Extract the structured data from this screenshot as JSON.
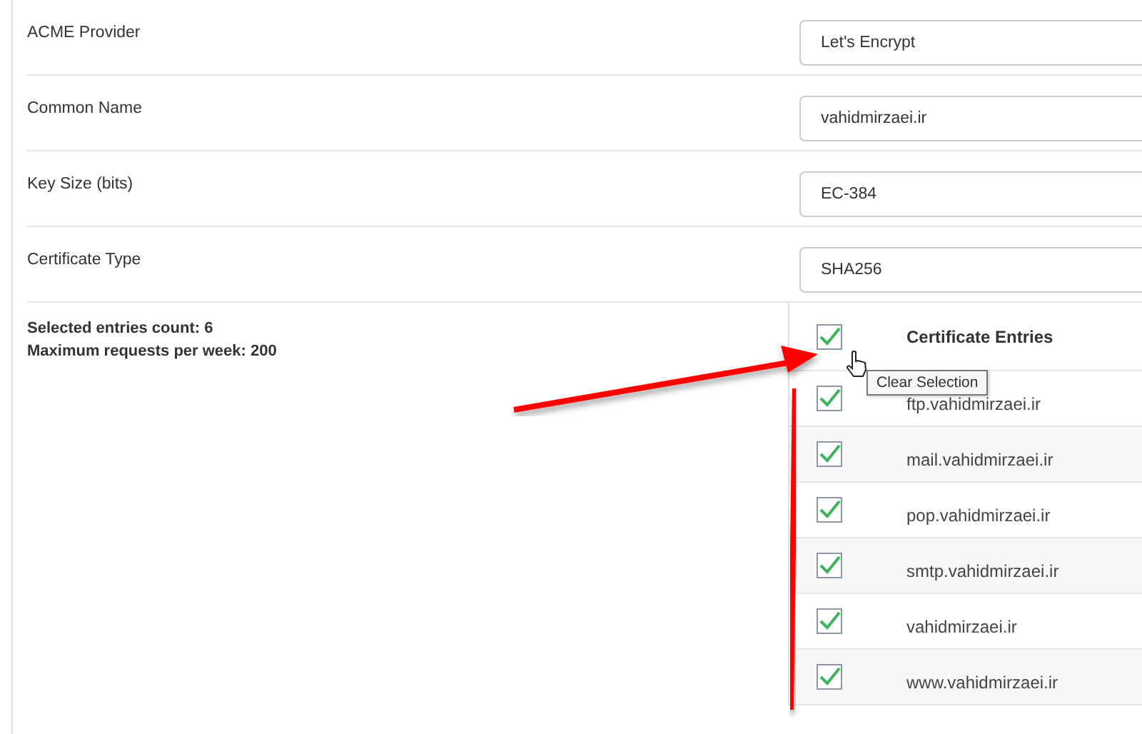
{
  "fields": [
    {
      "label": "ACME Provider",
      "value": "Let's Encrypt"
    },
    {
      "label": "Common Name",
      "value": "vahidmirzaei.ir"
    },
    {
      "label": "Key Size (bits)",
      "value": "EC-384"
    },
    {
      "label": "Certificate Type",
      "value": "SHA256"
    }
  ],
  "summary": [
    "Selected entries count: 6",
    "Maximum requests per week: 200"
  ],
  "entries": {
    "header": "Certificate Entries",
    "all_checked": true,
    "tooltip": "Clear Selection",
    "rows": [
      {
        "name": "ftp.vahidmirzaei.ir",
        "checked": true
      },
      {
        "name": "mail.vahidmirzaei.ir",
        "checked": true
      },
      {
        "name": "pop.vahidmirzaei.ir",
        "checked": true
      },
      {
        "name": "smtp.vahidmirzaei.ir",
        "checked": true
      },
      {
        "name": "vahidmirzaei.ir",
        "checked": true
      },
      {
        "name": "www.vahidmirzaei.ir",
        "checked": true
      }
    ]
  }
}
